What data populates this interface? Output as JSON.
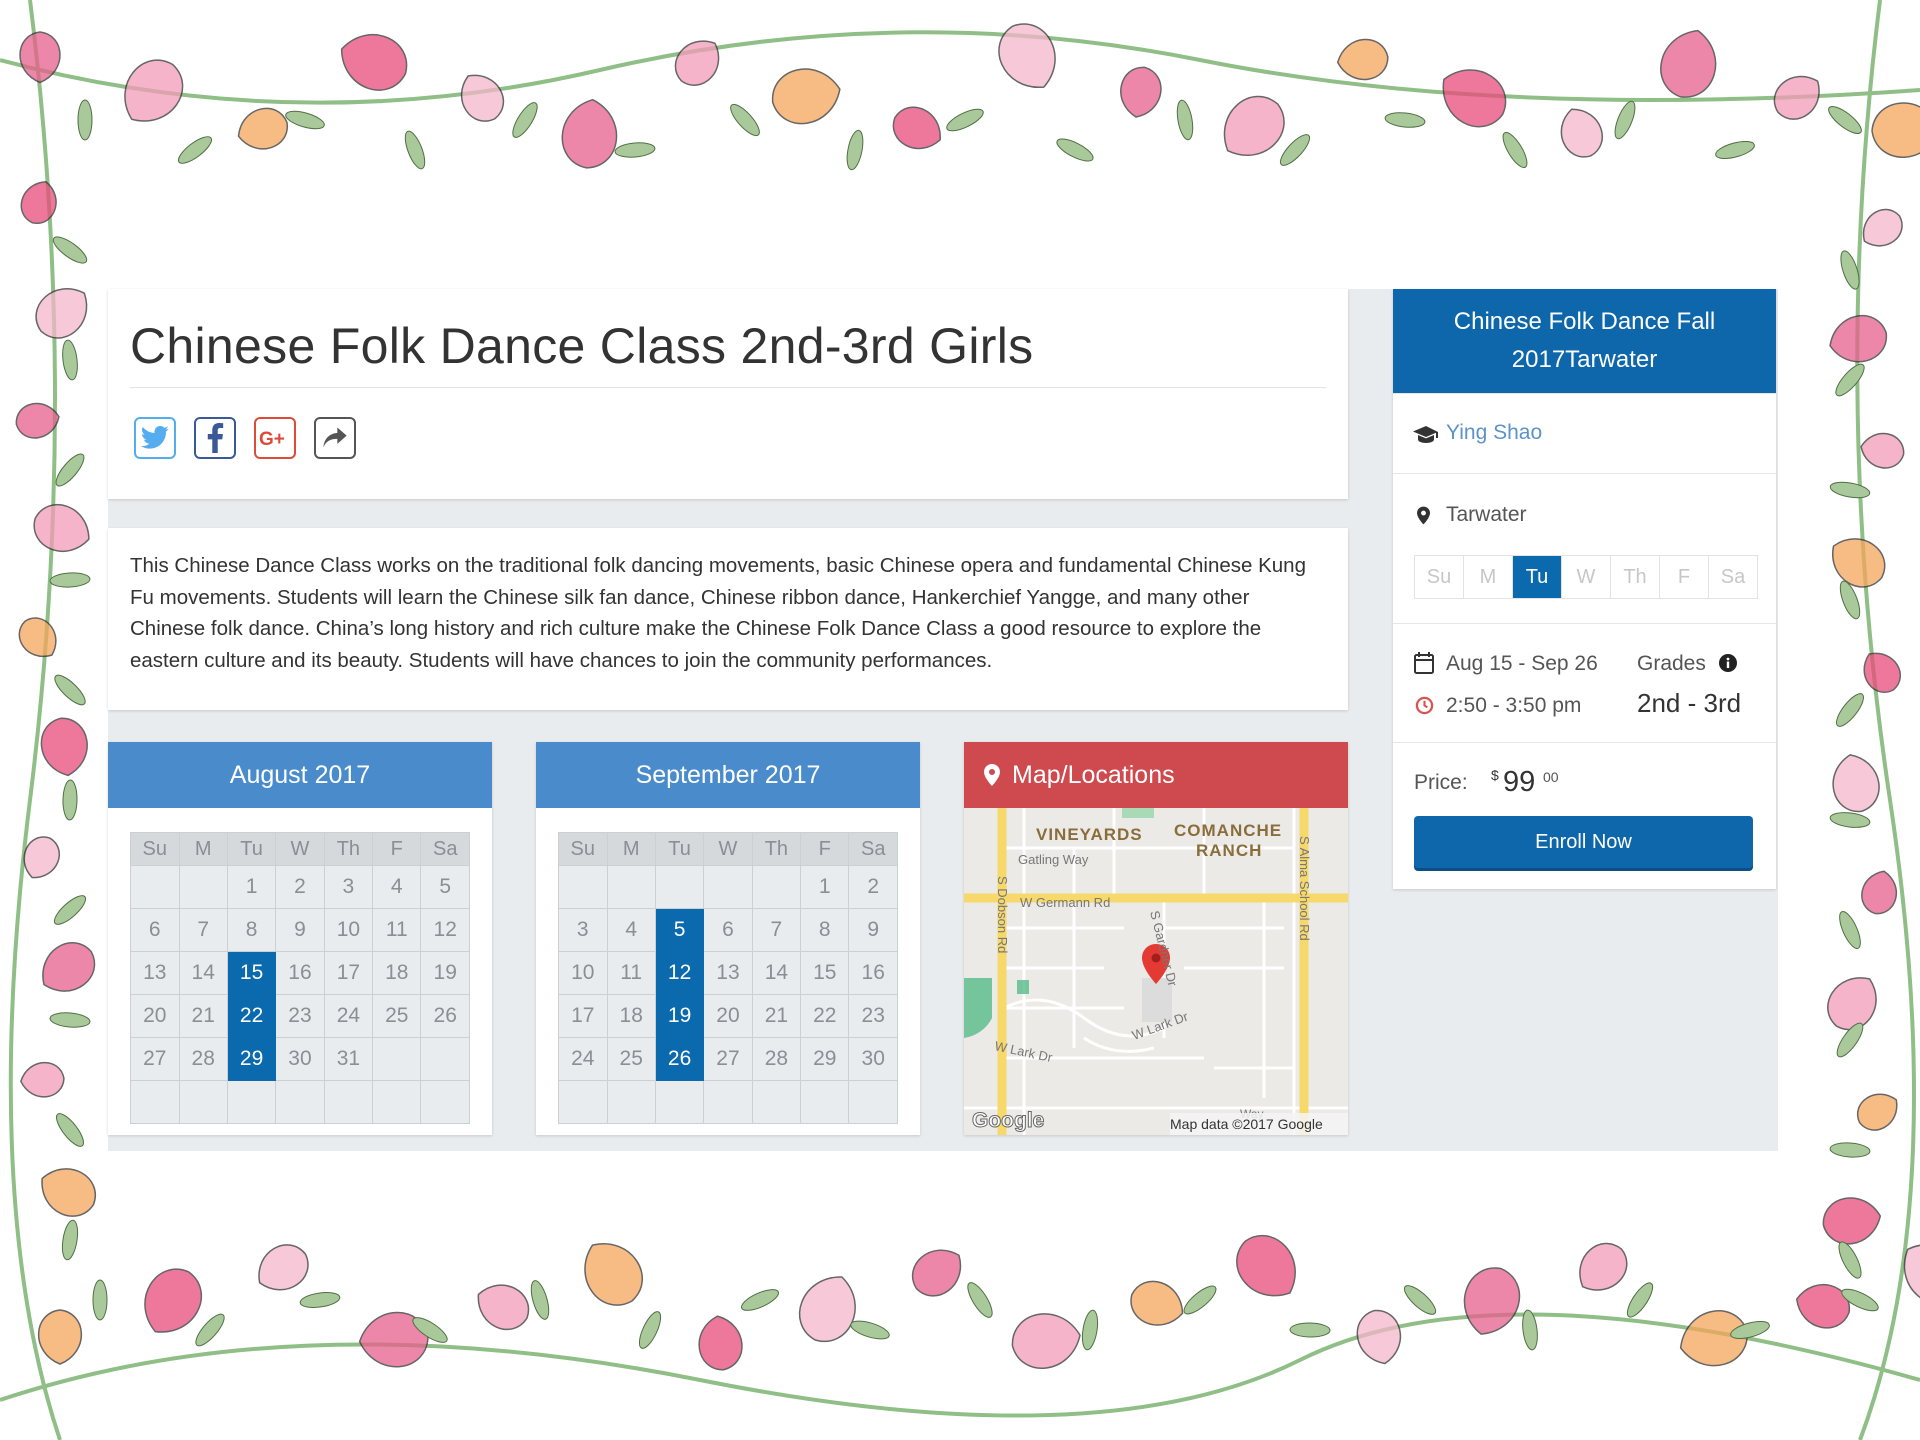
{
  "title": "Chinese Folk Dance Class 2nd-3rd Girls",
  "share": {
    "icons": [
      "twitter-icon",
      "facebook-icon",
      "google-plus-icon",
      "share-icon"
    ],
    "colors": {
      "twitter": "#55acee",
      "facebook": "#3b5998",
      "google": "#dd4b39",
      "share": "#555555"
    }
  },
  "description": "This Chinese Dance Class works on the traditional folk dancing movements, basic Chinese opera and fundamental Chinese Kung Fu movements. Students will learn the Chinese silk fan dance, Chinese ribbon dance, Hankerchief Yangge, and many other Chinese folk dance. China’s long history and rich culture make the Chinese Folk Dance Class a good resource to explore the eastern culture and its beauty. Students will have chances to join the community performances.",
  "calendars": [
    {
      "month": "August 2017",
      "weekdays": [
        "Su",
        "M",
        "Tu",
        "W",
        "Th",
        "F",
        "Sa"
      ],
      "weeks": [
        [
          "",
          "",
          "1",
          "2",
          "3",
          "4",
          "5"
        ],
        [
          "6",
          "7",
          "8",
          "9",
          "10",
          "11",
          "12"
        ],
        [
          "13",
          "14",
          "15",
          "16",
          "17",
          "18",
          "19"
        ],
        [
          "20",
          "21",
          "22",
          "23",
          "24",
          "25",
          "26"
        ],
        [
          "27",
          "28",
          "29",
          "30",
          "31",
          "",
          ""
        ],
        [
          "",
          "",
          "",
          "",
          "",
          "",
          ""
        ]
      ],
      "selected": [
        "15",
        "22",
        "29"
      ]
    },
    {
      "month": "September 2017",
      "weekdays": [
        "Su",
        "M",
        "Tu",
        "W",
        "Th",
        "F",
        "Sa"
      ],
      "weeks": [
        [
          "",
          "",
          "",
          "",
          "",
          "1",
          "2"
        ],
        [
          "3",
          "4",
          "5",
          "6",
          "7",
          "8",
          "9"
        ],
        [
          "10",
          "11",
          "12",
          "13",
          "14",
          "15",
          "16"
        ],
        [
          "17",
          "18",
          "19",
          "20",
          "21",
          "22",
          "23"
        ],
        [
          "24",
          "25",
          "26",
          "27",
          "28",
          "29",
          "30"
        ],
        [
          "",
          "",
          "",
          "",
          "",
          "",
          ""
        ]
      ],
      "selected": [
        "5",
        "12",
        "19",
        "26"
      ]
    }
  ],
  "map": {
    "header": "Map/Locations",
    "labels": {
      "vineyards": "VINEYARDS",
      "comanche_1": "COMANCHE",
      "comanche_2": "RANCH",
      "gatling": "Gatling Way",
      "germann": "W Germann Rd",
      "gardner": "S Gardner Dr",
      "dobson": "S Dobson Rd",
      "alma": "S Alma School Rd",
      "lark1": "W Lark Dr",
      "lark2": "W Lark Dr",
      "way": "Way",
      "google": "Google",
      "attribution": "Map data ©2017 Google"
    }
  },
  "sidebar": {
    "header": "Chinese Folk Dance Fall 2017Tarwater",
    "instructor": "Ying Shao",
    "location": "Tarwater",
    "days": [
      "Su",
      "M",
      "Tu",
      "W",
      "Th",
      "F",
      "Sa"
    ],
    "active_day": "Tu",
    "dates": "Aug 15 - Sep 26",
    "time": "2:50 - 3:50 pm",
    "grades_label": "Grades",
    "grades": "2nd - 3rd",
    "price_label": "Price:",
    "price_currency": "$",
    "price_whole": "99",
    "price_cents": "00",
    "enroll": "Enroll Now"
  }
}
